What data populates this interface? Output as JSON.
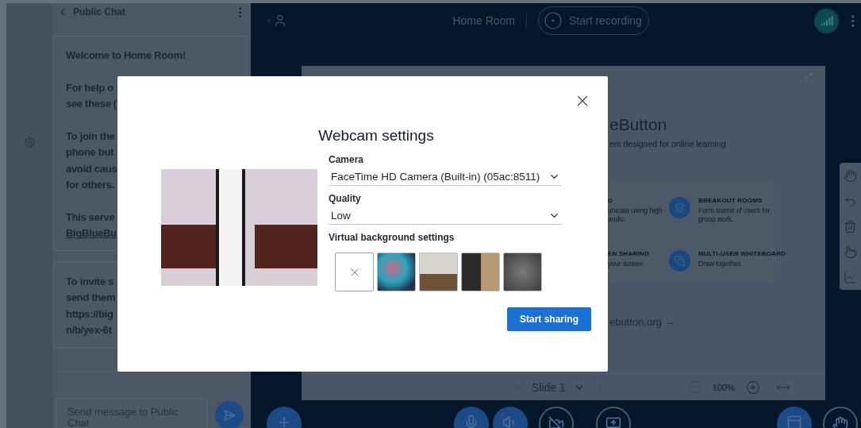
{
  "chat": {
    "title": "Public Chat",
    "messages": [
      {
        "paragraphs": [
          {
            "lines": [
              {
                "kind": "text",
                "text": "Welcome to Home Room!"
              }
            ]
          },
          {
            "lines": [
              {
                "kind": "text",
                "text": "For help o"
              },
              {
                "kind": "text",
                "text": "see these ("
              }
            ]
          },
          {
            "lines": [
              {
                "kind": "text",
                "text": "To join the"
              },
              {
                "kind": "text",
                "text": "phone but"
              },
              {
                "kind": "text",
                "text": "avoid caus"
              },
              {
                "kind": "text",
                "text": "for others."
              }
            ]
          },
          {
            "lines": [
              {
                "kind": "text",
                "text": "This serve"
              },
              {
                "kind": "link",
                "text": "BigBlueBu"
              }
            ]
          }
        ]
      },
      {
        "paragraphs": [
          {
            "lines": [
              {
                "kind": "text",
                "text": "To invite s"
              },
              {
                "kind": "text",
                "text": "send them"
              },
              {
                "kind": "text",
                "text": "https://big"
              },
              {
                "kind": "text",
                "text": "n/b/yex-6t"
              }
            ]
          }
        ]
      }
    ],
    "input": {
      "placeholder": "Send message to Public Chat"
    }
  },
  "top_bar": {
    "room_name": "Home Room",
    "record_button": "Start recording"
  },
  "slide": {
    "title": "eButton",
    "subtitle": "em designed for online learning",
    "features": [
      {
        "kind": "cut",
        "heading": "D",
        "lines": [
          "unicate using high",
          "audio."
        ]
      },
      {
        "kind": "full",
        "heading": "BREAKOUT ROOMS",
        "lines": [
          "Form teams of users for",
          "group work."
        ]
      },
      {
        "kind": "cut",
        "heading": "EN SHARING",
        "lines": [
          "your screen."
        ]
      },
      {
        "kind": "full",
        "heading": "MULTI-USER WHITEBOARD",
        "lines": [
          "Draw together."
        ]
      }
    ],
    "link": "ebutton.org →"
  },
  "slide_controls": {
    "slide_label": "Slide 1",
    "zoom": "100%"
  },
  "dialog": {
    "title": "Webcam settings",
    "fields": [
      {
        "label": "Camera",
        "value": "FaceTime HD Camera (Built-in) (05ac:8511)"
      },
      {
        "label": "Quality",
        "value": "Low"
      }
    ],
    "backgrounds_label": "Virtual background settings",
    "backgrounds": [
      {
        "kind": "none"
      },
      {
        "kind": "image"
      },
      {
        "kind": "image"
      },
      {
        "kind": "image"
      },
      {
        "kind": "image"
      }
    ],
    "submit": "Start sharing"
  }
}
